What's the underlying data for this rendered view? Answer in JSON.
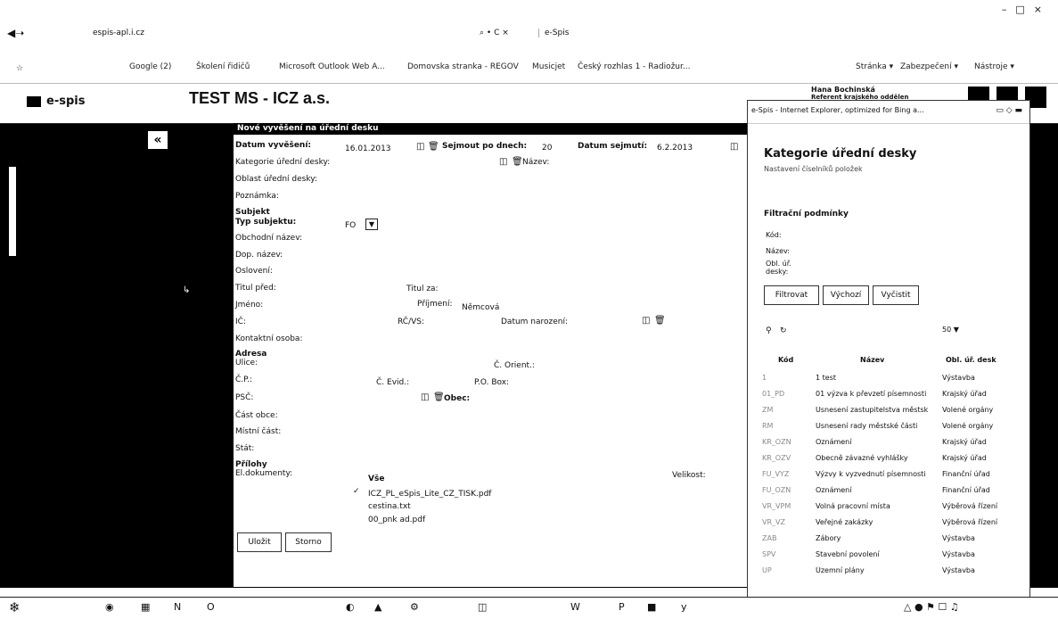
{
  "browser": {
    "address": "espis-apl.i.cz",
    "tab_title": "e-Spis",
    "tab_controls": "⌕ • C ×",
    "win_controls": [
      "–",
      "□",
      "×"
    ],
    "favorites": [
      "Google (2)",
      "Školení řidičů",
      "Microsoft Outlook Web A...",
      "Domovska stranka - REGOV",
      "Musicjet",
      "Český rozhlas 1 - Radiožur..."
    ],
    "right_tools": [
      "Stránka ▾",
      "Zabezpečení ▾",
      "Nástroje ▾"
    ]
  },
  "app": {
    "logo": "e-spis",
    "title": "TEST MS - ICZ a.s.",
    "user_name": "Hana Bochinská",
    "user_role": "Referent krajského oddělení"
  },
  "back_label": "«",
  "dialog": {
    "title": "Nové vyvěšení na úřední desku",
    "datum_vyveseni_label": "Datum vyvěšení:",
    "datum_vyveseni": "16.01.2013",
    "sejmout_label": "Sejmout po dnech:",
    "sejmout": "20",
    "datum_sejmuti_label": "Datum sejmutí:",
    "datum_sejmuti": "6.2.2013",
    "kategorie_label": "Kategorie úřední desky:",
    "nazev_label": "Název:",
    "oblast_label": "Oblast úřední desky:",
    "poznamka_label": "Poznámka:",
    "subjekt_label": "Subjekt",
    "typ_label": "Typ subjektu:",
    "typ_value": "FO",
    "obchodni_label": "Obchodní název:",
    "dop_label": "Dop. název:",
    "osloveni_label": "Oslovení:",
    "titul_pred_label": "Titul před:",
    "titul_za_label": "Titul za:",
    "jmeno_label": "Jméno:",
    "prijmeni_label": "Příjmení:",
    "prijmeni_value": "Němcová",
    "ic_label": "IČ:",
    "rc_label": "RČ/VS:",
    "datum_nar_label": "Datum narození:",
    "kontakt_label": "Kontaktní osoba:",
    "adresa_label": "Adresa",
    "ulice_label": "Ulice:",
    "c_orient_label": "Č. Orient.:",
    "cp_label": "Č.P.:",
    "c_evid_label": "Č. Evid.:",
    "pobox_label": "P.O. Box:",
    "psc_label": "PSČ:",
    "obec_label": "Obec:",
    "cast_obce_label": "Část obce:",
    "mistni_label": "Místní část:",
    "stat_label": "Stát:",
    "prilohy_label": "Přílohy",
    "eldok_label": "El.dokumenty:",
    "vse_label": "Vše",
    "velikost_label": "Velikost:",
    "files": [
      "ICZ_PL_eSpis_Lite_CZ_TISK.pdf",
      "cestina.txt",
      "00_pnk ad.pdf"
    ],
    "ulozit": "Uložit",
    "storno": "Storno"
  },
  "popup": {
    "window_title": "e-Spis - Internet Explorer, optimized for Bing a...",
    "heading": "Kategorie úřední desky",
    "subheading": "Nastavení číselníků položek",
    "filter_title": "Filtrační podmínky",
    "kod_label": "Kód:",
    "nazev_label": "Název:",
    "obl_label": "Obl. úř. desky:",
    "btn_filtrovat": "Filtrovat",
    "btn_vychozi": "Výchozí",
    "btn_vycistit": "Vyčistit",
    "page_size": "50",
    "columns": [
      "Kód",
      "Název",
      "Obl. úř. desk"
    ],
    "rows": [
      [
        "1",
        "1 test",
        "Výstavba"
      ],
      [
        "01_PD",
        "01 výzva k převzetí písemnosti",
        "Krajský úřad"
      ],
      [
        "ZM",
        "Usnesení zastupitelstva městsk",
        "Volené orgány"
      ],
      [
        "RM",
        "Usnesení rady městské části",
        "Volené orgány"
      ],
      [
        "KR_OZN",
        "Oznámení",
        "Krajský úřad"
      ],
      [
        "KR_OZV",
        "Obecně závazné vyhlášky",
        "Krajský úřad"
      ],
      [
        "FU_VYZ",
        "Výzvy k vyzvednutí písemnosti",
        "Finanční úřad"
      ],
      [
        "FU_OZN",
        "Oznámení",
        "Finanční úřad"
      ],
      [
        "VR_VPM",
        "Volná pracovní místa",
        "Výběrová řízení"
      ],
      [
        "VR_VZ",
        "Veřejné zakázky",
        "Výběrová řízení"
      ],
      [
        "ZAB",
        "Zábory",
        "Výstavba"
      ],
      [
        "SPV",
        "Stavební povolení",
        "Výstavba"
      ],
      [
        "UP",
        "Územní plány",
        "Výstavba"
      ]
    ]
  }
}
